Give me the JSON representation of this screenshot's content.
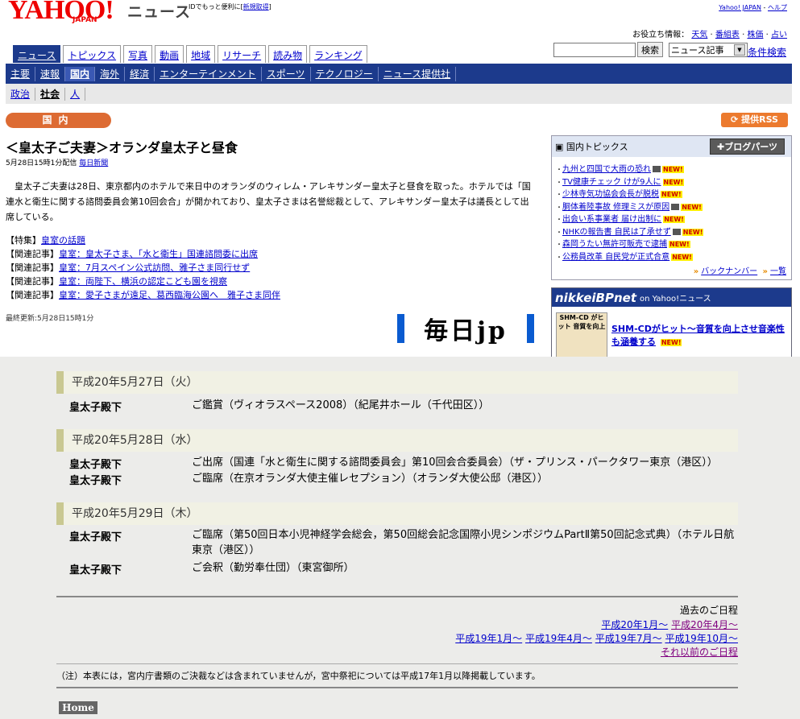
{
  "header": {
    "logo": "YAHOO!",
    "logo_sub": "JAPAN",
    "news_title": "ニュース",
    "tagline_text": "IDでもっと便利に[",
    "tagline_link": "新規取得",
    "tagline_end": "]",
    "yj_link": "Yahoo! JAPAN",
    "sep": " - ",
    "help_link": "ヘルプ",
    "info_label": "お役立ち情報：",
    "info_links": [
      "天気",
      "番組表",
      "株価",
      "占い"
    ]
  },
  "tabs": [
    "ニュース",
    "トピックス",
    "写真",
    "動画",
    "地域",
    "リサーチ",
    "読み物",
    "ランキング"
  ],
  "search": {
    "button": "検索",
    "select_value": "ニュース記事",
    "advanced": "条件検索"
  },
  "categories": [
    "主要",
    "速報",
    "国内",
    "海外",
    "経済",
    "エンターテインメント",
    "スポーツ",
    "テクノロジー",
    "ニュース提供社"
  ],
  "subcategories": [
    "政治",
    "社会",
    "人"
  ],
  "section_badge": "国内",
  "rss_label": "提供RSS",
  "article": {
    "title": "＜皇太子ご夫妻＞オランダ皇太子と昼食",
    "meta": "5月28日15時1分配信",
    "source": "毎日新聞",
    "body": "皇太子ご夫妻は28日、東京都内のホテルで来日中のオランダのウィレム・アレキサンダー皇太子と昼食を取った。ホテルでは「国連水と衛生に関する諮問委員会第10回会合」が開かれており、皇太子さまは名誉総裁として、アレキサンダー皇太子は議長として出席している。",
    "related": [
      {
        "prefix": "【特集】",
        "text": "皇室の話題"
      },
      {
        "prefix": "【関連記事】",
        "text": "皇室：皇太子さま、「水と衛生」国連諮問委に出席"
      },
      {
        "prefix": "【関連記事】",
        "text": "皇室：7月スペイン公式訪問、雅子さま同行せず"
      },
      {
        "prefix": "【関連記事】",
        "text": "皇室：両陛下、横浜の認定こども園を視察"
      },
      {
        "prefix": "【関連記事】",
        "text": "皇室：愛子さまが遠足、葛西臨海公園へ　雅子さま同伴"
      }
    ],
    "last_updated": "最終更新:5月28日15時1分",
    "logo_text": "毎日jp"
  },
  "topics": {
    "title": "国内トピックス",
    "blog_parts": "ブログパーツ",
    "items": [
      {
        "text": "九州と四国で大雨の恐れ",
        "cam": true
      },
      {
        "text": "TV健康チェック けが9人に",
        "cam": false
      },
      {
        "text": "少林寺気功協会会長が脱税",
        "cam": false
      },
      {
        "text": "胴体着陸事故 修理ミスが原因",
        "cam": true
      },
      {
        "text": "出会い系事業者 届け出制に",
        "cam": false
      },
      {
        "text": "NHKの報告書 自民は了承せず",
        "cam": true
      },
      {
        "text": "森岡うたい無許可販売で逮捕",
        "cam": false
      },
      {
        "text": "公務員改革 自民党が正式合意",
        "cam": false
      }
    ],
    "new_label": "NEW!",
    "backnumber": "バックナンバー",
    "list": "一覧"
  },
  "nikkei": {
    "brand": "nikkeiBPnet",
    "on": "on Yahoo!ニュース",
    "thumb_text": "SHM-CD がヒット 音質を向上",
    "link": "SHM-CDがヒット～音質を向上させ音楽性も涵養する",
    "new_label": "NEW!"
  },
  "schedule": [
    {
      "date": "平成20年5月27日（火）",
      "rows": [
        {
          "who": "皇太子殿下",
          "what": "ご鑑賞（ヴィオラスペース2008）（紀尾井ホール（千代田区））"
        }
      ]
    },
    {
      "date": "平成20年5月28日（水）",
      "rows": [
        {
          "who": "皇太子殿下",
          "what": "ご出席（国連「水と衛生に関する諮問委員会」第10回会合委員会）（ザ・プリンス・パークタワー東京（港区））"
        },
        {
          "who": "皇太子殿下",
          "what": "ご臨席（在京オランダ大使主催レセプション）（オランダ大使公邸（港区））"
        }
      ]
    },
    {
      "date": "平成20年5月29日（木）",
      "rows": [
        {
          "who": "皇太子殿下",
          "what": "ご臨席（第50回日本小児神経学会総会，第50回総会記念国際小児シンポジウムPartⅡ第50回記念式典）（ホテル日航東京（港区））"
        },
        {
          "who": "皇太子殿下",
          "what": "ご会釈（勤労奉仕団）（東宮御所）"
        }
      ]
    }
  ],
  "past": {
    "title": "過去のご日程",
    "row1": [
      "平成20年1月～",
      "平成20年4月～"
    ],
    "row2": [
      "平成19年1月～",
      "平成19年4月～",
      "平成19年7月～",
      "平成19年10月～"
    ],
    "older": "それ以前のご日程"
  },
  "note": "（注）本表には，宮内庁書類のご決裁などは含まれていませんが，宮中祭祀については平成17年1月以降掲載しています。",
  "home": "Home"
}
